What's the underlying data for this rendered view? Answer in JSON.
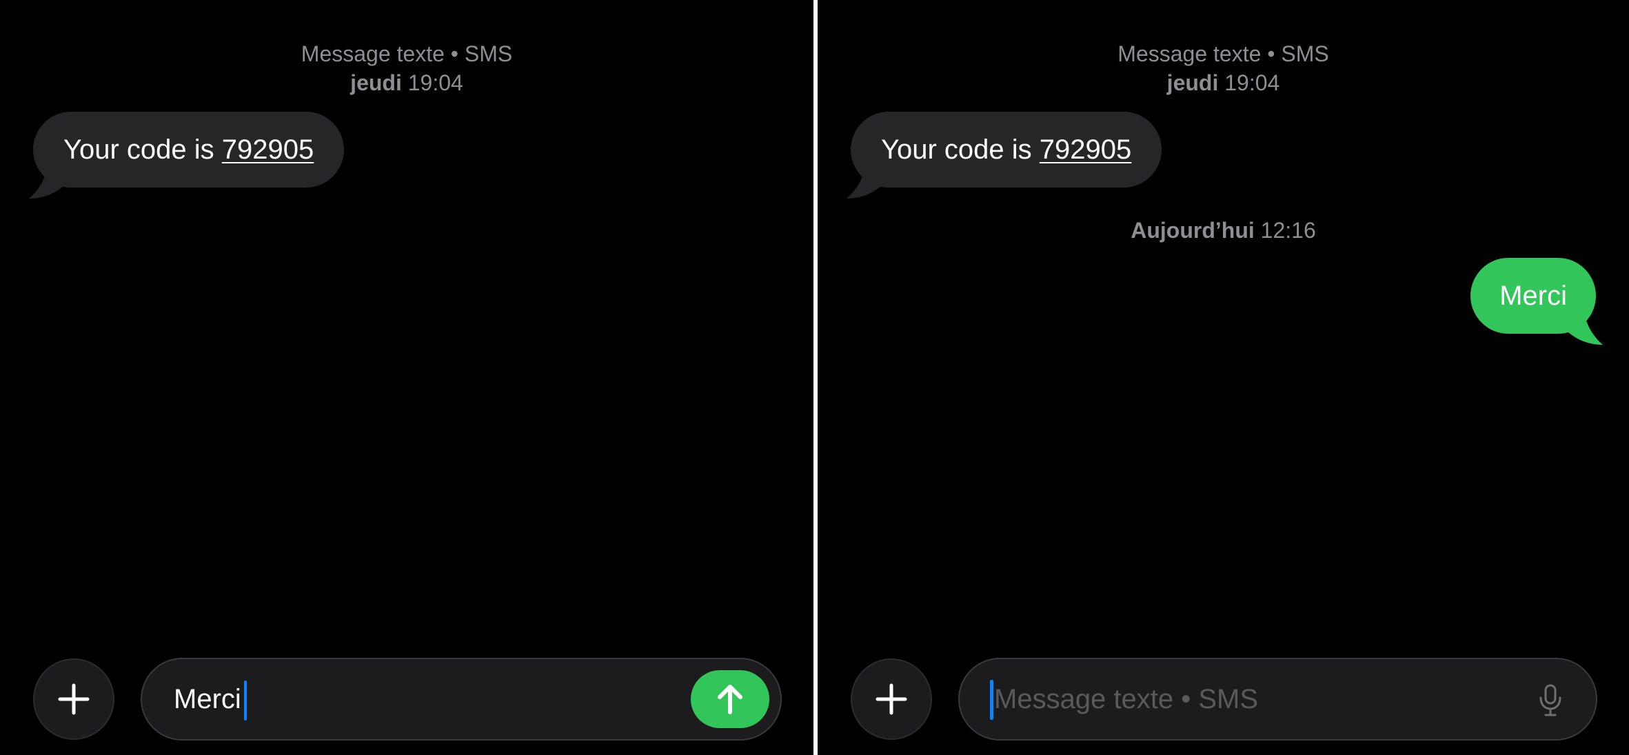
{
  "colors": {
    "background": "#000000",
    "incoming_bubble": "#262628",
    "outgoing_bubble": "#31c55a",
    "meta_text": "#8e8e93",
    "caret": "#0a84ff",
    "send_button": "#31c55a"
  },
  "left": {
    "header": {
      "service": "Message texte • SMS",
      "day": "jeudi",
      "time": "19:04"
    },
    "incoming_message": {
      "prefix": "Your code is ",
      "code": "792905"
    },
    "composer": {
      "add_icon": "plus-icon",
      "input_value": "Merci",
      "send_icon": "arrow-up-icon"
    }
  },
  "right": {
    "header": {
      "service": "Message texte • SMS",
      "day": "jeudi",
      "time": "19:04"
    },
    "incoming_message": {
      "prefix": "Your code is ",
      "code": "792905"
    },
    "sent_timestamp": {
      "day": "Aujourd’hui",
      "time": "12:16"
    },
    "outgoing_message": {
      "text": "Merci"
    },
    "composer": {
      "add_icon": "plus-icon",
      "placeholder": "Message texte • SMS",
      "mic_icon": "microphone-icon"
    }
  }
}
